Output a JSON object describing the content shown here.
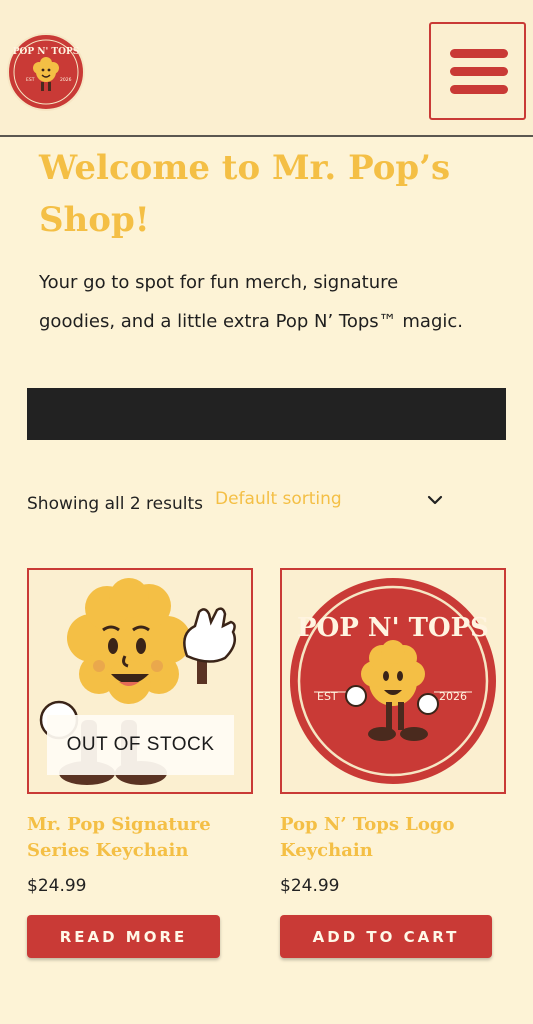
{
  "header": {
    "logo_text": "POP N' TOPS",
    "logo_est": "EST",
    "logo_year": "2026"
  },
  "main": {
    "title": "Welcome to Mr. Pop’s Shop!",
    "intro_line1": "Your go to spot for fun merch, signature",
    "intro_line2": "goodies, and a little extra Pop N’ Tops™ magic."
  },
  "shop": {
    "result_count": "Showing all 2 results",
    "sort_selected": "Default sorting"
  },
  "products": [
    {
      "title_line1": "Mr. Pop Signature",
      "title_line2": "Series Keychain",
      "price": "$24.99",
      "badge": "OUT OF STOCK",
      "button": "READ MORE"
    },
    {
      "title_line1": "Pop N’ Tops Logo",
      "title_line2": "Keychain",
      "price": "$24.99",
      "logo_text": "POP N' TOPS",
      "logo_est": "EST",
      "logo_year": "2026",
      "button": "ADD TO CART"
    }
  ],
  "colors": {
    "background": "#fdf3d6",
    "accent_red": "#c93a36",
    "accent_yellow": "#f4bf45"
  }
}
